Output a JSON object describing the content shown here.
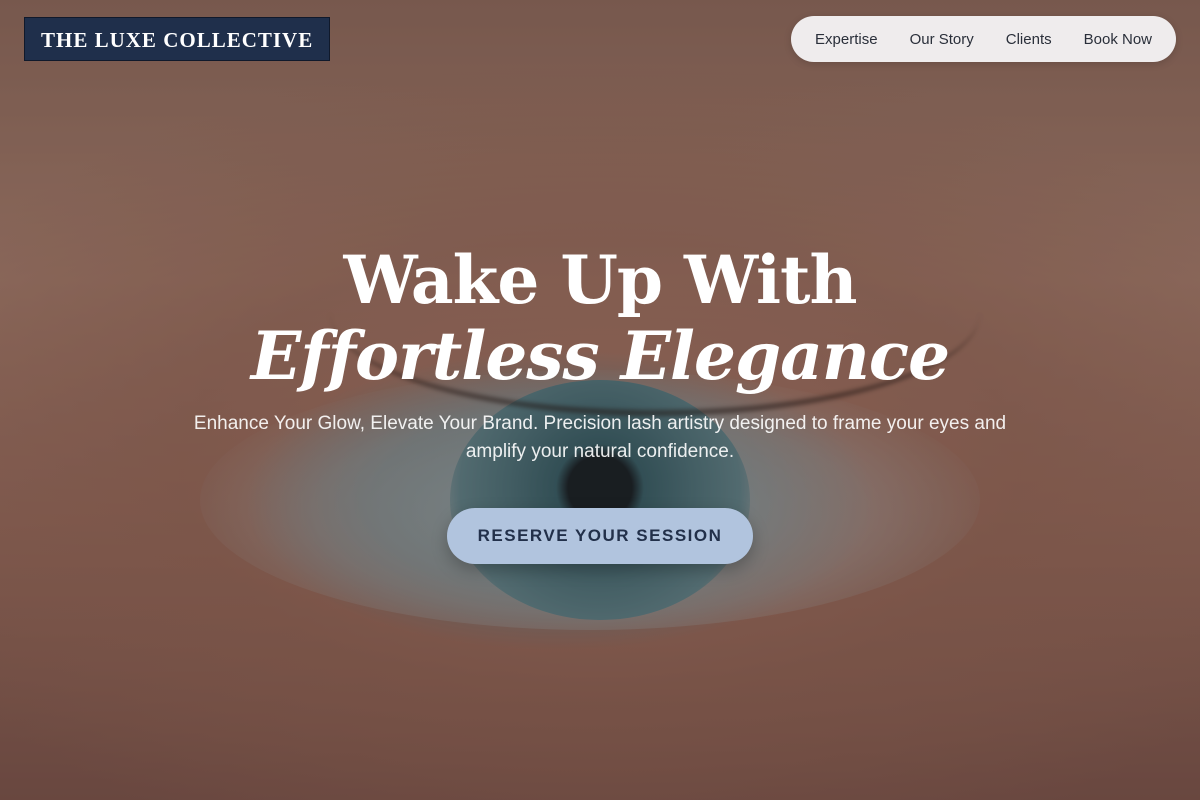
{
  "brand": {
    "logo_text": "THE LUXE COLLECTIVE"
  },
  "nav": {
    "items": [
      {
        "label": "Expertise"
      },
      {
        "label": "Our Story"
      },
      {
        "label": "Clients"
      },
      {
        "label": "Book Now"
      }
    ]
  },
  "hero": {
    "headline_line1": "Wake Up With",
    "headline_line2": "Effortless Elegance",
    "subtext": "Enhance Your Glow, Elevate Your Brand. Precision lash artistry designed to frame your eyes and amplify your natural confidence.",
    "cta_label": "RESERVE YOUR SESSION"
  },
  "colors": {
    "logo_bg": "#1f2f4b",
    "nav_bg": "#f4f3f4",
    "cta_bg": "#b1c4de",
    "cta_text": "#22304a"
  }
}
